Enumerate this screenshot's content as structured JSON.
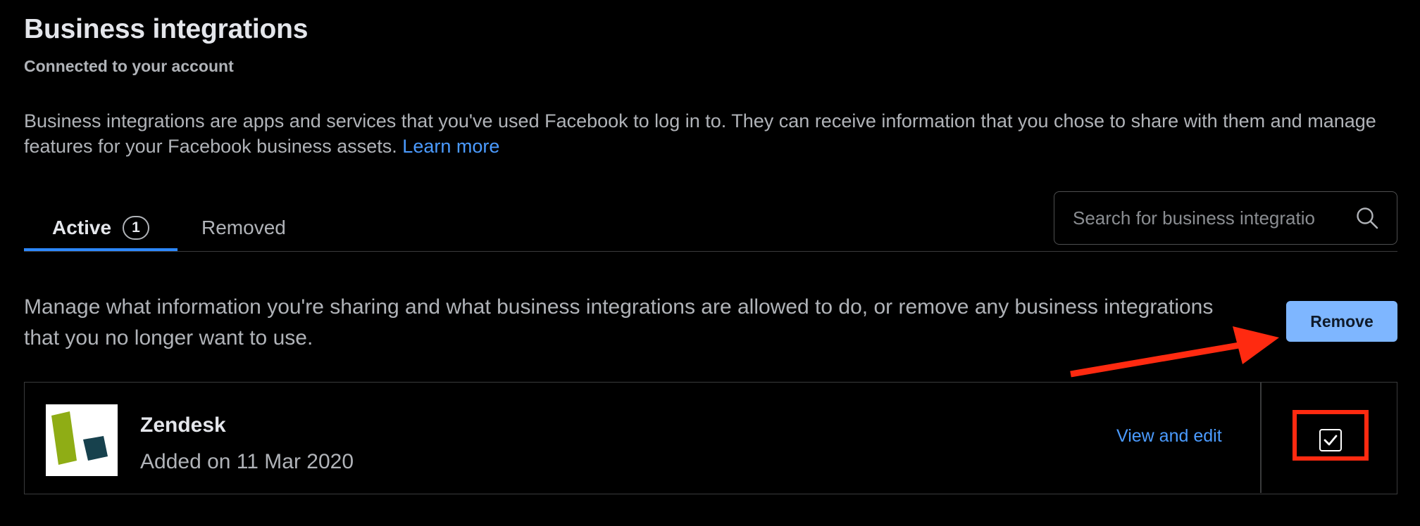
{
  "header": {
    "title": "Business integrations",
    "subtitle": "Connected to your account"
  },
  "description": {
    "text": "Business integrations are apps and services that you've used Facebook to log in to. They can receive information that you chose to share with them and manage features for your Facebook business assets.",
    "learn_more_label": "Learn more"
  },
  "tabs": [
    {
      "label": "Active",
      "count": "1",
      "active": true
    },
    {
      "label": "Removed",
      "active": false
    }
  ],
  "search": {
    "placeholder": "Search for business integratio",
    "icon": "search-icon"
  },
  "manage": {
    "text": "Manage what information you're sharing and what business integrations are allowed to do, or remove any business integrations that you no longer want to use.",
    "remove_button_label": "Remove"
  },
  "integrations": [
    {
      "name": "Zendesk",
      "added": "Added on 11 Mar 2020",
      "action_label": "View and edit",
      "checked": true,
      "logo": "zendesk-logo"
    }
  ],
  "colors": {
    "background": "#000000",
    "link": "#4b9bff",
    "tab_underline": "#2d88ff",
    "remove_button": "#7eb6ff",
    "annotation": "#ff2a10"
  }
}
